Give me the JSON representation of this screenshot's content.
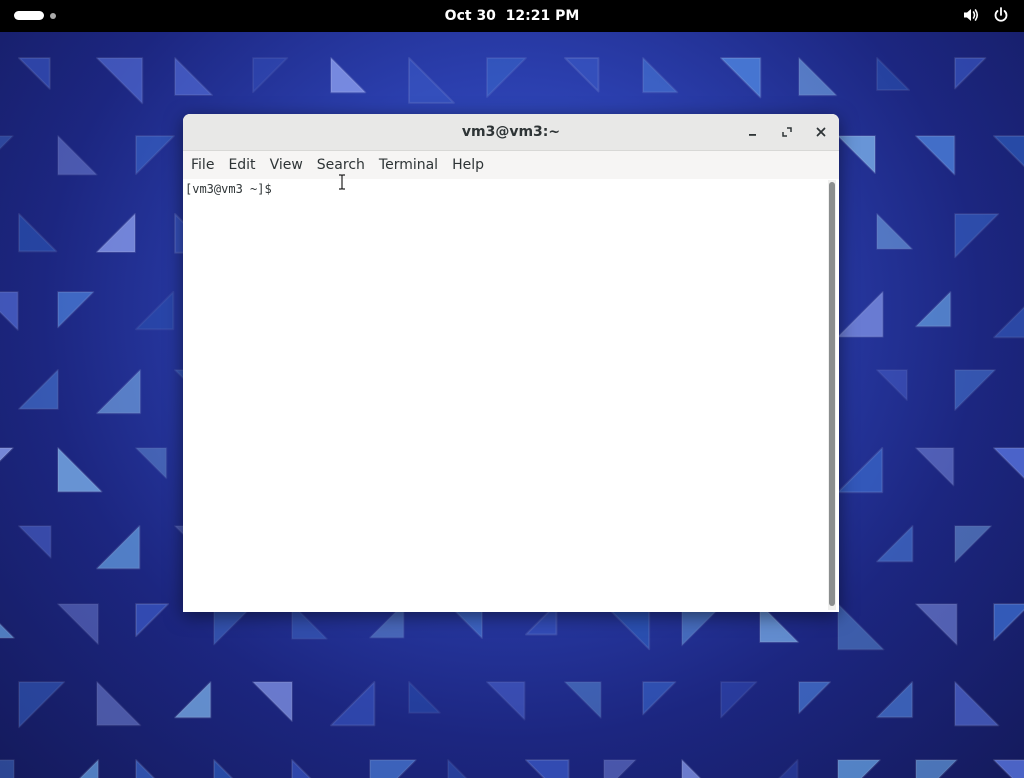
{
  "topbar": {
    "date": "Oct 30",
    "time": "12:21 PM",
    "activities_icon": "activities-pill-icon",
    "volume_icon": "volume-icon",
    "power_icon": "power-icon"
  },
  "window": {
    "title": "vm3@vm3:~",
    "minimize_icon": "minimize-icon",
    "maximize_icon": "maximize-icon",
    "close_icon": "close-icon"
  },
  "menu": {
    "items": [
      "File",
      "Edit",
      "View",
      "Search",
      "Terminal",
      "Help"
    ]
  },
  "terminal": {
    "prompt": "[vm3@vm3 ~]$ "
  },
  "colors": {
    "topbar_bg": "#000000",
    "titlebar_bg": "#e8e8e7",
    "menubar_bg": "#f6f5f4",
    "terminal_bg": "#ffffff",
    "wallpaper_primary": "#2b3fae",
    "wallpaper_accent": "#6aa8e8"
  }
}
